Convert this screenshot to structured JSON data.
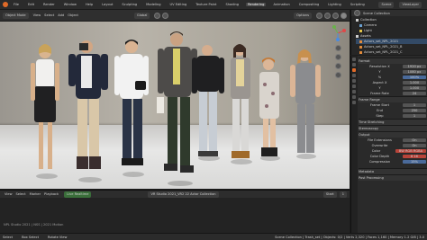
{
  "menu": {
    "items": [
      "File",
      "Edit",
      "Render",
      "Window",
      "Help"
    ],
    "tabs": [
      "Layout",
      "Sculpting",
      "UV Editing",
      "Texture Paint",
      "Shading",
      "Animation",
      "Rendering",
      "Compositing",
      "Scripting",
      "Lighting",
      "Compositing",
      "Geometry Nodes",
      "Scripting"
    ]
  },
  "menu_labels": {
    "tabs_visible": [
      "Layout",
      "Sculpting",
      "Modeling",
      "UV Editing",
      "Texture Paint",
      "Shading",
      "Animation",
      "Rendering",
      "Compositing",
      "Lighting",
      "Geometry Nodes",
      "Scripting"
    ],
    "active_tab": "Rendering",
    "scene": "Scene",
    "view_layer": "ViewLayer"
  },
  "viewport_header": {
    "mode": "Object Mode",
    "view": "View",
    "select": "Select",
    "add": "Add",
    "object": "Object",
    "transform": "Global",
    "options": "Options"
  },
  "timeline": {
    "menu": [
      "View",
      "Select",
      "Marker"
    ],
    "playback": "Playback",
    "frame_label": "Start",
    "frame_current": "1",
    "live": "Live Realtime",
    "clip_label": "VR Studio 2021_VR2 22 Actor Collection",
    "bottom_text": "NPL Studio 2021 | NSS | 2021 Motion"
  },
  "status": {
    "left": [
      "Select",
      "Box Select",
      "Rotate View"
    ],
    "right": "Scene Collection | Trash_set | Objects: 0/2 | Verts 2,320 | Faces 1,160 | Memory 1.2 GiB | 3.0"
  },
  "outliner": {
    "title": "Scene Collection",
    "items": [
      "Collection",
      "Camera",
      "Light",
      "Assets",
      "Actors_set_NPL_2021",
      "Actors_set_NPL_2021_B",
      "Actors_set_NPL_2021_C"
    ]
  },
  "properties": {
    "sections": [
      {
        "label": "Format",
        "type": "header"
      },
      {
        "label": "Resolution X",
        "value": "1920 px"
      },
      {
        "label": "Y",
        "value": "1080 px"
      },
      {
        "label": "%",
        "value": "100%"
      },
      {
        "label": "Aspect X",
        "value": "1.000"
      },
      {
        "label": "Y",
        "value": "1.000"
      },
      {
        "label": "Frame Rate",
        "value": "24"
      },
      {
        "label": "Frame Range",
        "type": "header"
      },
      {
        "label": "Frame Start",
        "value": "1"
      },
      {
        "label": "End",
        "value": "250"
      },
      {
        "label": "Step",
        "value": "1"
      },
      {
        "label": "Time Stretching",
        "type": "header"
      },
      {
        "label": "Stereoscopy",
        "type": "header"
      },
      {
        "label": "Output",
        "type": "header"
      },
      {
        "label": "File Extensions",
        "value": "On"
      },
      {
        "label": "Overwrite",
        "value": "On"
      },
      {
        "label": "Color",
        "value": "BW  RGB  RGBA"
      },
      {
        "label": "Color Depth",
        "value": "8  16"
      },
      {
        "label": "Compression",
        "value": "15%"
      },
      {
        "label": "Metadata",
        "type": "header"
      },
      {
        "label": "Post Processing",
        "type": "header"
      }
    ]
  },
  "colors": {
    "accent": "#e06a28",
    "active_tab": "#474747",
    "panel": "#2a2a2a"
  }
}
